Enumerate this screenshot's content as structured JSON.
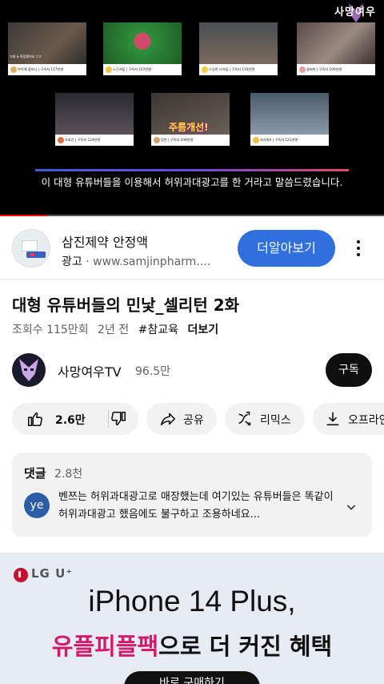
{
  "player": {
    "watermark": "사망여우",
    "subtitle": "이 대형 유튜버들을 이용해서 허위과대광고를 한 거라고 말씀드렸습니다.",
    "progress_fraction": 0.12,
    "thumbnails": [
      {
        "caption": "박막례 할머니 | 구독자 117만명",
        "overlay": "거제 & 편집됐어요 ㅎㅎ",
        "banner": ""
      },
      {
        "caption": "소근커플 | 구독자 107만명",
        "overlay": "",
        "banner": ""
      },
      {
        "caption": "수상한 녀석들 | 구독자 115만명",
        "overlay": "",
        "banner": ""
      },
      {
        "caption": "윰찌띠 | 구독자 100만명",
        "overlay": "",
        "banner": ""
      },
      {
        "caption": "조효진 | 구독자 124만명",
        "overlay": "",
        "banner": ""
      },
      {
        "caption": "장한 | 구독자 244만명",
        "overlay": "",
        "banner": "주름개선!"
      },
      {
        "caption": "회사원A | 구독자 121만명",
        "overlay": "",
        "banner": ""
      }
    ]
  },
  "ad": {
    "title": "삼진제약 안정액",
    "label": "광고",
    "url": "www.samjinpharm....",
    "cta": "더알아보기"
  },
  "video": {
    "title": "대형 유튜버들의 민낯_셀리턴 2화",
    "views": "조회수 115만회",
    "age": "2년 전",
    "tag": "#참교육",
    "more": "더보기"
  },
  "channel": {
    "name": "사망여우TV",
    "subs": "96.5만",
    "subscribe": "구독"
  },
  "actions": {
    "likes": "2.6만",
    "share": "공유",
    "remix": "리믹스",
    "offline": "오프라인"
  },
  "comments": {
    "heading": "댓글",
    "count": "2.8천",
    "avatar": "ye",
    "text": "벤쯔는 허위과대광고로 매장했는데 여기있는 유튜버들은 똑같이 허위과대광고 했음에도 불구하고 조용하네요..."
  },
  "banner_ad": {
    "brand": "LG U⁺",
    "headline": "iPhone 14 Plus,",
    "promo_highlight": "유플피플팩",
    "promo_rest": "으로 더 커진 혜택",
    "button": "바로 구매하기"
  },
  "colors": {
    "accent_blue": "#2f6fde",
    "progress_red": "#ff0000",
    "promo_pink": "#d6196a"
  }
}
